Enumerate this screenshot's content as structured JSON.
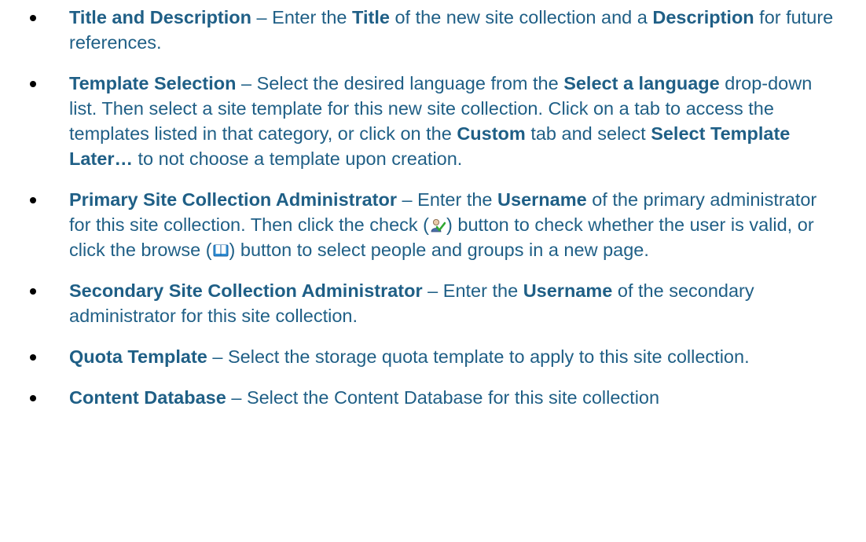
{
  "items": [
    {
      "term": "Title and Description",
      "dash": " – ",
      "p1": "Enter the ",
      "k1": "Title",
      "p2": " of the new site collection and a ",
      "k2": "Description",
      "p3": " for future references."
    },
    {
      "term": "Template Selection",
      "dash": " – ",
      "p1": "Select the desired language from the ",
      "k1": "Select a language",
      "p2": " drop-down list. Then select a site template for this new site collection. Click on a tab to access the templates listed in that category, or click on the ",
      "k2": "Custom",
      "p3": " tab and select ",
      "k3": "Select Template Later…",
      "p4": " to not choose a template upon creation."
    },
    {
      "term": "Primary Site Collection Administrator",
      "dash": " – ",
      "p1": "Enter the ",
      "k1": "Username",
      "p2": " of the primary administrator for this site collection. Then click the check (",
      "p3": ") button to check whether the user is valid, or click the browse (",
      "p4": ") button to select people and groups in a new page."
    },
    {
      "term": "Secondary Site Collection Administrator",
      "dash": " – ",
      "p1": "Enter the ",
      "k1": "Username",
      "p2": " of the secondary administrator for this site collection."
    },
    {
      "term": "Quota Template",
      "dash": " – ",
      "p1": "Select the storage quota template to apply to this site collection."
    },
    {
      "term": "Content Database",
      "dash": " – ",
      "p1": "Select the Content Database for this site collection"
    }
  ],
  "icons": {
    "check": "check-names-icon",
    "browse": "address-book-icon"
  },
  "colors": {
    "text": "#1f5f86",
    "bullet": "#000000"
  }
}
